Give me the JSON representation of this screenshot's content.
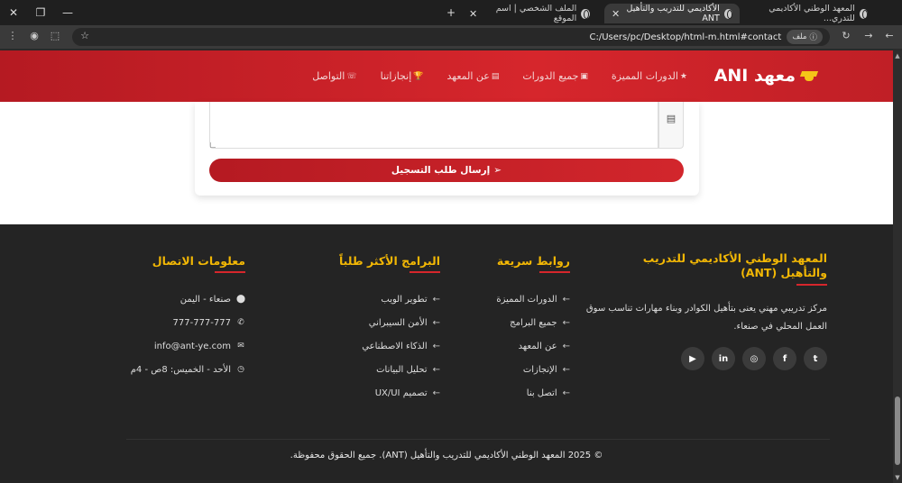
{
  "browser": {
    "tabs": [
      {
        "title": "المعهد الوطني الأكاديمي للتدري..."
      },
      {
        "title": "الأكاديمي للتدريب والتأهيل ANT"
      },
      {
        "title": "الملف الشخصي | اسم الموقع"
      }
    ],
    "new_tab": "+",
    "url": "C:/Users/pc/Desktop/html-m.html#contact",
    "file_chip": "ملف"
  },
  "header": {
    "logo": "معهد ANI",
    "nav": [
      {
        "label": "الدورات المميزة",
        "icon": "★"
      },
      {
        "label": "جميع الدورات",
        "icon": "▣"
      },
      {
        "label": "عن المعهد",
        "icon": "▤"
      },
      {
        "label": "إنجازاتنا",
        "icon": "🏆"
      },
      {
        "label": "التواصل",
        "icon": "☏"
      }
    ]
  },
  "form": {
    "submit_label": "إرسال طلب التسجيل"
  },
  "footer": {
    "about": {
      "title": "المعهد الوطني الأكاديمي للتدريب والتأهيل (ANT)",
      "text": "مركز تدريبي مهني يعنى بتأهيل الكوادر وبناء مهارات تناسب سوق العمل المحلي في صنعاء."
    },
    "quick_links": {
      "title": "روابط سريعة",
      "items": [
        "الدورات المميزة",
        "جميع البرامج",
        "عن المعهد",
        "الإنجازات",
        "اتصل بنا"
      ]
    },
    "programs": {
      "title": "البرامج الأكثر طلباً",
      "items": [
        "تطوير الويب",
        "الأمن السيبراني",
        "الذكاء الاصطناعي",
        "تحليل البيانات",
        "تصميم UX/UI"
      ]
    },
    "contact": {
      "title": "معلومات الاتصال",
      "items": [
        {
          "icon": "location-icon",
          "text": "صنعاء - اليمن"
        },
        {
          "icon": "phone-icon",
          "text": "777-777-777"
        },
        {
          "icon": "email-icon",
          "text": "info@ant-ye.com"
        },
        {
          "icon": "clock-icon",
          "text": "الأحد - الخميس: 8ص - 4م"
        }
      ]
    },
    "socials": [
      "twitter-icon",
      "facebook-icon",
      "instagram-icon",
      "linkedin-icon",
      "youtube-icon"
    ],
    "copyright": "© 2025 المعهد الوطني الأكاديمي للتدريب والتأهيل (ANT). جميع الحقوق محفوظة."
  }
}
